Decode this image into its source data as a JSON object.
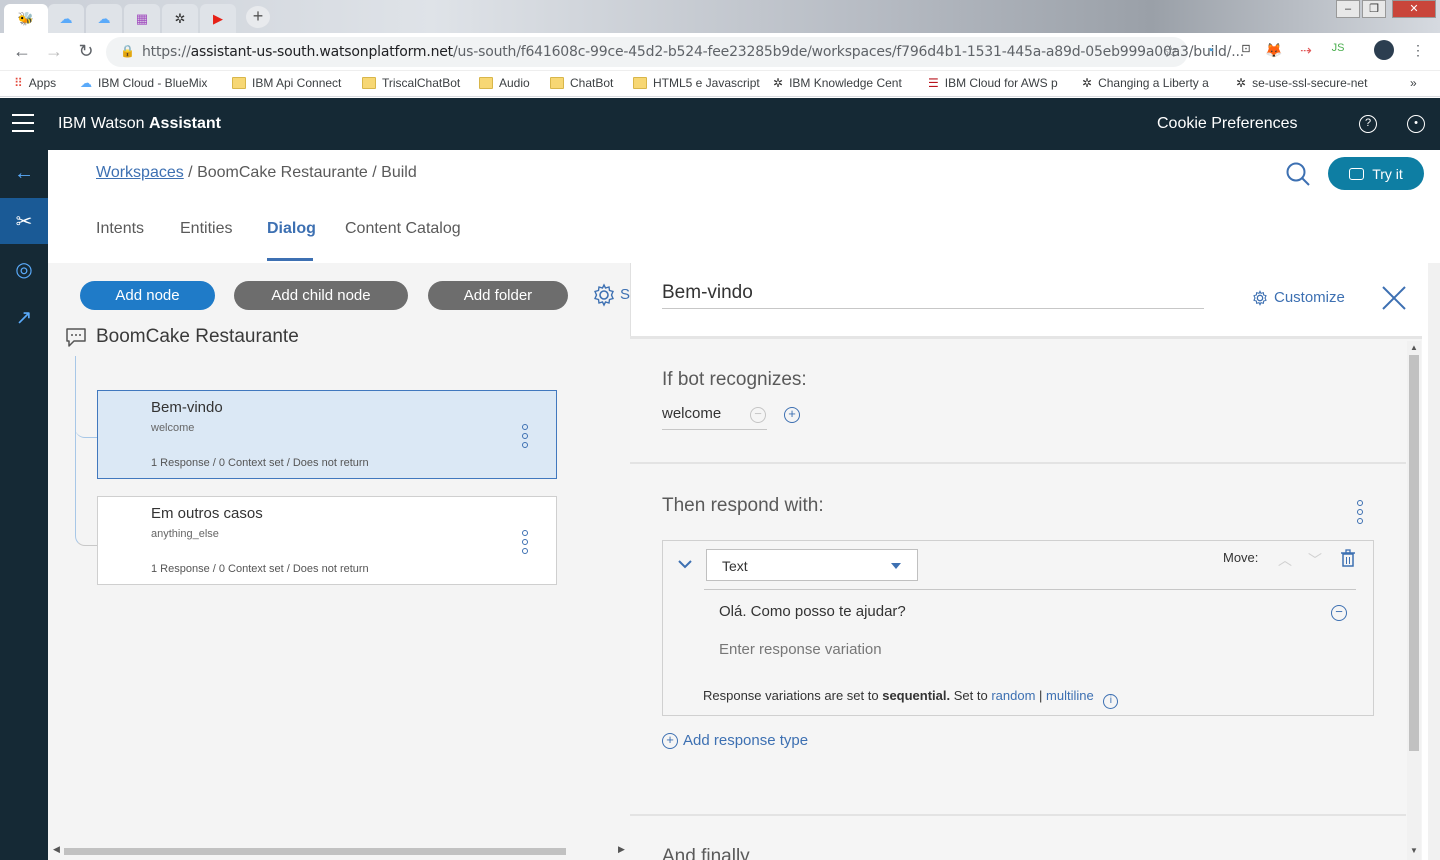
{
  "browser": {
    "url_prefix": "https://",
    "url_host": "assistant-us-south.watsonplatform.net",
    "url_path": "/us-south/f641608c-99ce-45d2-b524-fee23285b9de/workspaces/f796d4b1-1531-445a-a89d-05eb999a00a3/build/...",
    "bookmarks": [
      "Apps",
      "IBM Cloud - BlueMix",
      "IBM Api Connect",
      "TriscalChatBot",
      "Audio",
      "ChatBot",
      "HTML5 e Javascript",
      "IBM Knowledge Cent",
      "IBM Cloud for AWS p",
      "Changing a Liberty a",
      "se-use-ssl-secure-net"
    ],
    "more_bookmarks": "»"
  },
  "header": {
    "brand_prefix": "IBM Watson ",
    "brand_strong": "Assistant",
    "cookie_label": "Cookie Preferences"
  },
  "breadcrumb": {
    "workspaces": "Workspaces",
    "rest": " / BoomCake Restaurante / Build"
  },
  "try_it": "Try it",
  "tabs": [
    "Intents",
    "Entities",
    "Dialog",
    "Content Catalog"
  ],
  "toolbar": {
    "add_node": "Add node",
    "add_child_node": "Add child node",
    "add_folder": "Add folder",
    "settings_partial": "S"
  },
  "tree": {
    "root": "BoomCake Restaurante",
    "nodes": [
      {
        "title": "Bem-vindo",
        "condition": "welcome",
        "meta": "1 Response / 0 Context set / Does not return"
      },
      {
        "title": "Em outros casos",
        "condition": "anything_else",
        "meta": "1 Response / 0 Context set / Does not return"
      }
    ]
  },
  "editor": {
    "node_name": "Bem-vindo",
    "customize": "Customize",
    "if_bot_recognizes": "If bot recognizes:",
    "condition": "welcome",
    "then_respond": "Then respond with:",
    "response_type": "Text",
    "move_label": "Move:",
    "variation": "Olá. Como posso te ajudar?",
    "variation_placeholder": "Enter response variation",
    "note_prefix": "Response variations are set to ",
    "note_mode": "sequential.",
    "note_set_to": " Set to ",
    "note_random": "random",
    "note_sep": " | ",
    "note_multiline": "multiline",
    "add_response_type": "Add response type",
    "and_finally": "And finally"
  },
  "colors": {
    "header_bg": "#152935",
    "accent_blue": "#3d70b2",
    "primary_button": "#1f7bc8",
    "secondary_button": "#6d6d6d",
    "try_it": "#0e7ea3",
    "selected_node_bg": "#dbe8f5"
  }
}
